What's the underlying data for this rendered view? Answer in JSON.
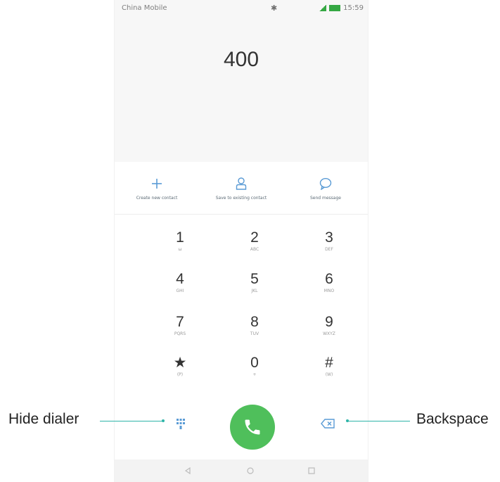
{
  "status_bar": {
    "carrier": "China Mobile",
    "time": "15:59"
  },
  "dialer": {
    "number": "400"
  },
  "quick_actions": [
    {
      "label": "Create new contact",
      "icon": "plus-icon"
    },
    {
      "label": "Save to existing contact",
      "icon": "person-icon"
    },
    {
      "label": "Send message",
      "icon": "message-icon"
    }
  ],
  "keypad": [
    {
      "digit": "1",
      "letters": "ω"
    },
    {
      "digit": "2",
      "letters": "ABC"
    },
    {
      "digit": "3",
      "letters": "DEF"
    },
    {
      "digit": "4",
      "letters": "GHI"
    },
    {
      "digit": "5",
      "letters": "JKL"
    },
    {
      "digit": "6",
      "letters": "MNO"
    },
    {
      "digit": "7",
      "letters": "PQRS"
    },
    {
      "digit": "8",
      "letters": "TUV"
    },
    {
      "digit": "9",
      "letters": "WXYZ"
    },
    {
      "digit": "★",
      "letters": "(P)"
    },
    {
      "digit": "0",
      "letters": "+"
    },
    {
      "digit": "#",
      "letters": "(W)"
    }
  ],
  "bottom_controls": {
    "hide_dialer_icon": "dialpad-collapse-icon",
    "call_icon": "phone-icon",
    "backspace_icon": "backspace-icon"
  },
  "callouts": {
    "hide_dialer": "Hide dialer",
    "backspace": "Backspace"
  },
  "colors": {
    "call_button": "#4fbf5b",
    "accent_blue": "#5a9bd5",
    "callout_line": "#2eb5a8",
    "status_green": "#35a843"
  }
}
